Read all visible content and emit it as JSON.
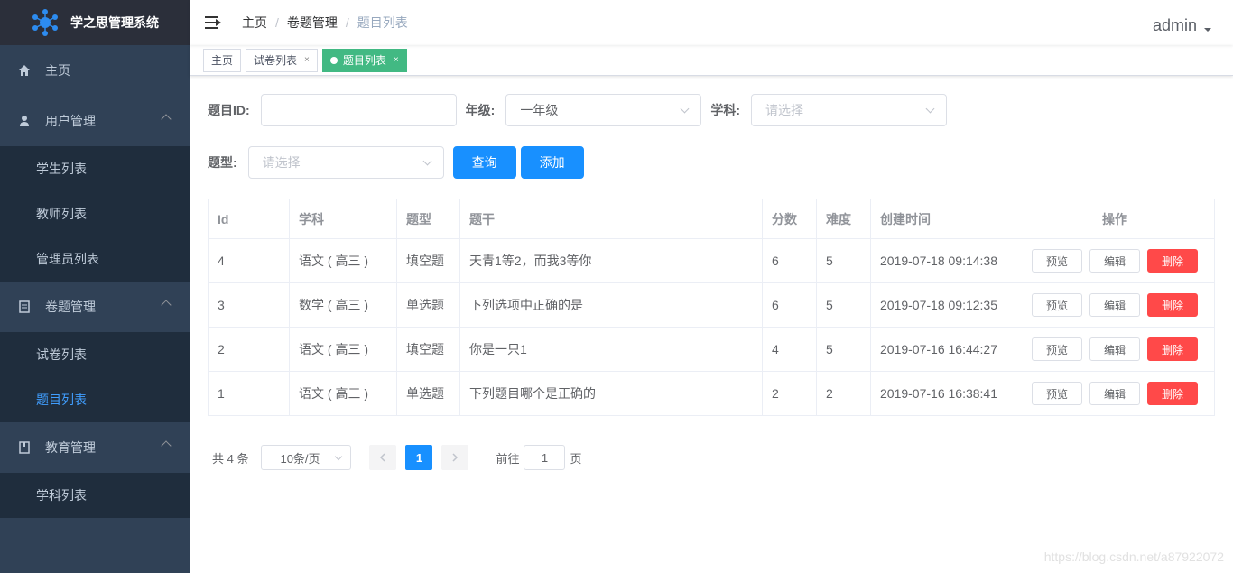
{
  "app": {
    "title": "学之思管理系统"
  },
  "sidebar": {
    "items": [
      {
        "label": "主页",
        "icon": "home-icon"
      },
      {
        "label": "用户管理",
        "icon": "user-icon",
        "children": [
          "学生列表",
          "教师列表",
          "管理员列表"
        ]
      },
      {
        "label": "卷题管理",
        "icon": "document-icon",
        "children": [
          "试卷列表",
          "题目列表"
        ]
      },
      {
        "label": "教育管理",
        "icon": "book-icon",
        "children": [
          "学科列表"
        ]
      }
    ],
    "active": "题目列表"
  },
  "header": {
    "breadcrumb": [
      "主页",
      "卷题管理",
      "题目列表"
    ],
    "user": "admin"
  },
  "tags": [
    {
      "label": "主页",
      "closable": false
    },
    {
      "label": "试卷列表",
      "closable": true,
      "close": "×"
    },
    {
      "label": "题目列表",
      "closable": true,
      "close": "×",
      "active": true
    }
  ],
  "filters": {
    "id_label": "题目ID:",
    "id_value": "",
    "grade_label": "年级:",
    "grade_value": "一年级",
    "subject_label": "学科:",
    "subject_placeholder": "请选择",
    "type_label": "题型:",
    "type_placeholder": "请选择",
    "query_button": "查询",
    "add_button": "添加"
  },
  "table": {
    "columns": [
      "Id",
      "学科",
      "题型",
      "题干",
      "分数",
      "难度",
      "创建时间",
      "操作"
    ],
    "rows": [
      {
        "id": "4",
        "subject": "语文 ( 高三 )",
        "type": "填空题",
        "stem": "天青1等2，而我3等你",
        "score": "6",
        "difficulty": "5",
        "created": "2019-07-18 09:14:38"
      },
      {
        "id": "3",
        "subject": "数学 ( 高三 )",
        "type": "单选题",
        "stem": "下列选项中正确的是",
        "score": "6",
        "difficulty": "5",
        "created": "2019-07-18 09:12:35"
      },
      {
        "id": "2",
        "subject": "语文 ( 高三 )",
        "type": "填空题",
        "stem": "你是一只1",
        "score": "4",
        "difficulty": "5",
        "created": "2019-07-16 16:44:27"
      },
      {
        "id": "1",
        "subject": "语文 ( 高三 )",
        "type": "单选题",
        "stem": "下列题目哪个是正确的",
        "score": "2",
        "difficulty": "2",
        "created": "2019-07-16 16:38:41"
      }
    ],
    "actions": {
      "preview": "预览",
      "edit": "编辑",
      "delete": "删除"
    }
  },
  "pagination": {
    "total": "共 4 条",
    "page_size": "10条/页",
    "current": "1",
    "goto_prefix": "前往",
    "goto_value": "1",
    "goto_suffix": "页"
  },
  "watermark": "https://blog.csdn.net/a87922072",
  "colors": {
    "sidebar": "#304156",
    "submenu": "#1f2d3d",
    "primary": "#1890ff",
    "danger": "#ff4949",
    "tag_active": "#42b983"
  }
}
